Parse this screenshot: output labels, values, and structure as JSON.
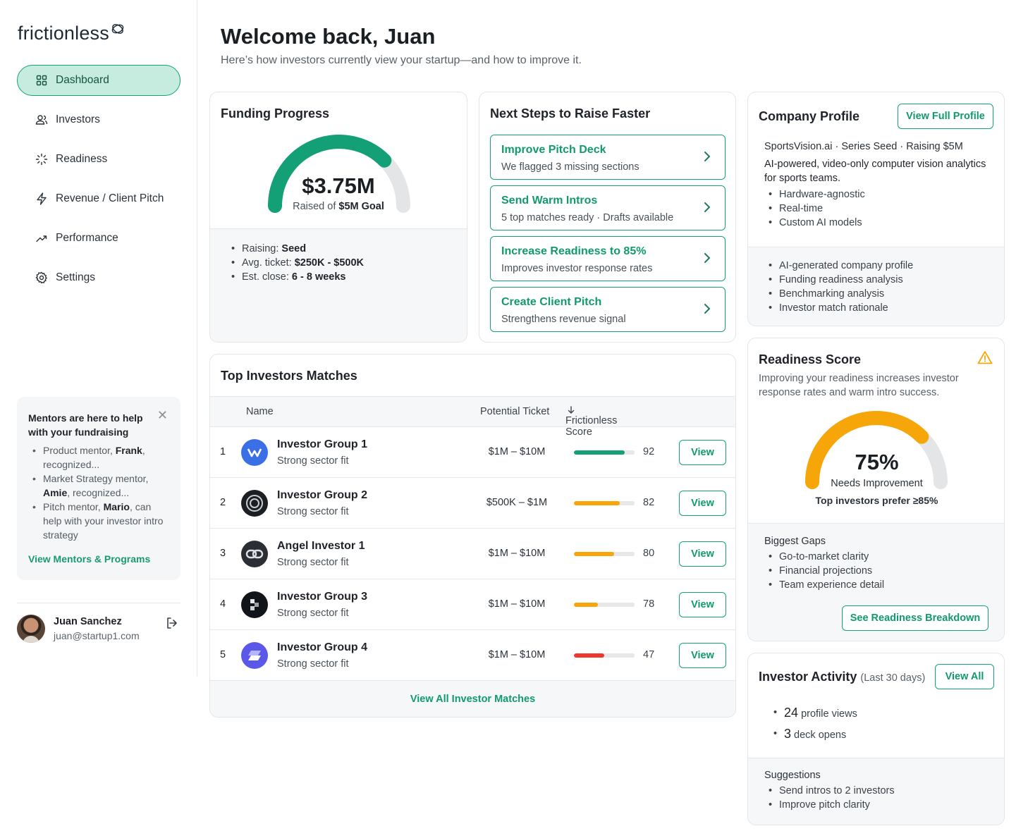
{
  "app": {
    "logo": "frictionless"
  },
  "nav": [
    {
      "label": "Dashboard",
      "icon": "grid-icon",
      "active": true
    },
    {
      "label": "Investors",
      "icon": "users-icon"
    },
    {
      "label": "Readiness",
      "icon": "loader-icon"
    },
    {
      "label": "Revenue / Client Pitch",
      "icon": "bolt-icon"
    },
    {
      "label": "Performance",
      "icon": "trending-up-icon"
    },
    {
      "label": "Settings",
      "icon": "gear-icon"
    }
  ],
  "mentor": {
    "title": "Mentors are here to help with your fundraising",
    "items": [
      {
        "pre": "Product mentor, ",
        "name": "Frank",
        "post": ", recognized..."
      },
      {
        "pre": "Market Strategy mentor, ",
        "name": "Amie",
        "post": ", recognized..."
      },
      {
        "pre": "Pitch mentor, ",
        "name": "Mario",
        "post": ", can help with your investor intro strategy"
      }
    ],
    "link": "View Mentors & Programs"
  },
  "user": {
    "name": "Juan Sanchez",
    "email": "juan@startup1.com"
  },
  "header": {
    "title": "Welcome back, Juan",
    "subtitle": "Here’s how investors currently view your startup—and how to improve it."
  },
  "funding": {
    "title": "Funding Progress",
    "amount": "$3.75M",
    "raised_prefix": "Raised of ",
    "goal": "$5M Goal",
    "progress": 0.75,
    "details": [
      {
        "label": "Raising: ",
        "value": "Seed"
      },
      {
        "label": "Avg. ticket: ",
        "value": "$250K - $500K"
      },
      {
        "label": "Est. close: ",
        "value": "6 - 8 weeks"
      }
    ]
  },
  "next_steps": {
    "title": "Next Steps to Raise Faster",
    "items": [
      {
        "title": "Improve Pitch Deck",
        "desc": "We flagged 3 missing sections"
      },
      {
        "title": "Send Warm Intros",
        "desc": "5 top matches ready · Drafts available"
      },
      {
        "title": "Increase Readiness to 85%",
        "desc": "Improves investor response rates"
      },
      {
        "title": "Create Client Pitch",
        "desc": "Strengthens revenue signal"
      }
    ]
  },
  "company": {
    "title": "Company Profile",
    "button": "View Full Profile",
    "meta": "SportsVision.ai · Series Seed · Raising $5M",
    "desc": "AI-powered, video-only computer vision analytics for sports teams.",
    "features": [
      "Hardware-agnostic",
      "Real-time",
      "Custom AI models"
    ],
    "extras": [
      "AI-generated company profile",
      "Funding readiness analysis",
      "Benchmarking analysis",
      "Investor match rationale"
    ]
  },
  "readiness": {
    "title": "Readiness Score",
    "desc": "Improving your readiness increases investor response rates and warm intro success.",
    "score": "75%",
    "progress": 0.75,
    "status": "Needs Improvement",
    "note": "Top investors prefer ≥85%",
    "gaps_title": "Biggest Gaps",
    "gaps": [
      "Go-to-market clarity",
      "Financial projections",
      "Team experience detail"
    ],
    "button": "See Readiness Breakdown",
    "colors": {
      "accent": "#f6a609"
    }
  },
  "activity": {
    "title": "Investor Activity",
    "period": "(Last 30 days)",
    "button": "View All",
    "stats": [
      {
        "num": "24",
        "label": "profile views"
      },
      {
        "num": "3",
        "label": "deck opens"
      }
    ],
    "suggestions_title": "Suggestions",
    "suggestions": [
      "Send intros to 2 investors",
      "Improve pitch clarity"
    ]
  },
  "matches": {
    "title": "Top Investors Matches",
    "columns": {
      "name": "Name",
      "ticket": "Potential Ticket",
      "score": "Frictionless Score"
    },
    "rows": [
      {
        "rank": "1",
        "name": "Investor Group 1",
        "fit": "Strong sector fit",
        "ticket": "$1M – $10M",
        "score": "92",
        "pct": 0.84,
        "color": "#14a074",
        "logo": "#3b6fe6",
        "action": "View"
      },
      {
        "rank": "2",
        "name": "Investor Group 2",
        "fit": "Strong sector fit",
        "ticket": "$500K – $1M",
        "score": "82",
        "pct": 0.76,
        "color": "#f6a609",
        "logo": "#1b1f23",
        "action": "View"
      },
      {
        "rank": "3",
        "name": "Angel Investor 1",
        "fit": "Strong sector fit",
        "ticket": "$1M – $10M",
        "score": "80",
        "pct": 0.66,
        "color": "#f6a609",
        "logo": "#2b2f35",
        "action": "View"
      },
      {
        "rank": "4",
        "name": "Investor Group 3",
        "fit": "Strong sector fit",
        "ticket": "$1M – $10M",
        "score": "78",
        "pct": 0.4,
        "color": "#f6a609",
        "logo": "#111418",
        "action": "View"
      },
      {
        "rank": "5",
        "name": "Investor Group 4",
        "fit": "Strong sector fit",
        "ticket": "$1M – $10M",
        "score": "47",
        "pct": 0.5,
        "color": "#f0372c",
        "logo": "#5b57e8",
        "action": "View"
      }
    ],
    "footer": "View All Investor Matches"
  }
}
